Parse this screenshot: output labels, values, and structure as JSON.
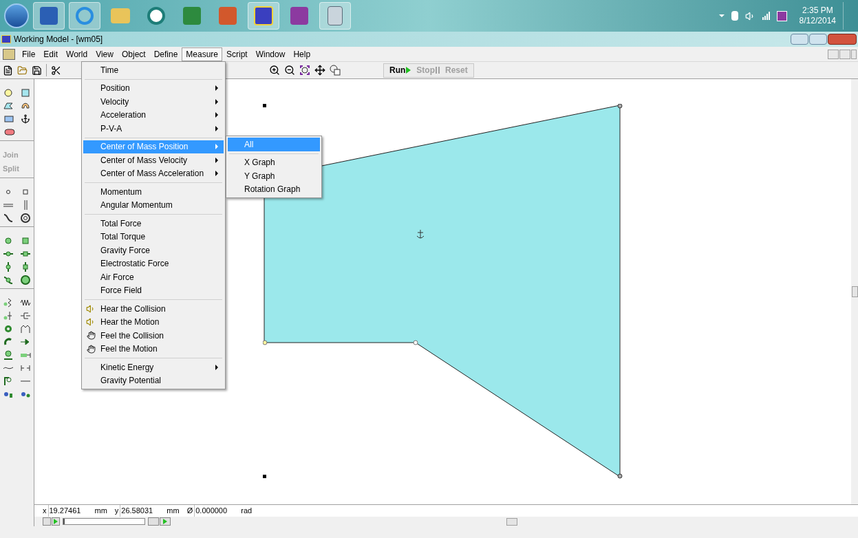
{
  "tray": {
    "time": "2:35 PM",
    "date": "8/12/2014"
  },
  "window": {
    "title": "Working Model - [wm05]"
  },
  "menubar": [
    {
      "label": "File",
      "selected": false
    },
    {
      "label": "Edit",
      "selected": false
    },
    {
      "label": "World",
      "selected": false
    },
    {
      "label": "View",
      "selected": false
    },
    {
      "label": "Object",
      "selected": false
    },
    {
      "label": "Define",
      "selected": false
    },
    {
      "label": "Measure",
      "selected": true
    },
    {
      "label": "Script",
      "selected": false
    },
    {
      "label": "Window",
      "selected": false
    },
    {
      "label": "Help",
      "selected": false
    }
  ],
  "run_controls": [
    {
      "label": "Run",
      "disabled": false
    },
    {
      "label": "Stop",
      "disabled": true
    },
    {
      "label": "Reset",
      "disabled": true
    }
  ],
  "palette_buttons": [
    {
      "label": "Join",
      "disabled": true
    },
    {
      "label": "Split",
      "disabled": true
    }
  ],
  "menu": {
    "groups": [
      [
        {
          "label": "Time",
          "kind": "plain",
          "selected": false
        }
      ],
      [
        {
          "label": "Position",
          "kind": "submenu",
          "selected": false
        },
        {
          "label": "Velocity",
          "kind": "submenu",
          "selected": false
        },
        {
          "label": "Acceleration",
          "kind": "submenu",
          "selected": false
        },
        {
          "label": "P-V-A",
          "kind": "submenu",
          "selected": false
        }
      ],
      [
        {
          "label": "Center of Mass Position",
          "kind": "submenu",
          "selected": true
        },
        {
          "label": "Center of Mass Velocity",
          "kind": "submenu",
          "selected": false
        },
        {
          "label": "Center of Mass Acceleration",
          "kind": "submenu",
          "selected": false
        }
      ],
      [
        {
          "label": "Momentum",
          "kind": "plain",
          "selected": false
        },
        {
          "label": "Angular Momentum",
          "kind": "plain",
          "selected": false
        }
      ],
      [
        {
          "label": "Total Force",
          "kind": "plain",
          "selected": false
        },
        {
          "label": "Total Torque",
          "kind": "plain",
          "selected": false
        },
        {
          "label": "Gravity Force",
          "kind": "plain",
          "selected": false
        },
        {
          "label": "Electrostatic Force",
          "kind": "plain",
          "selected": false
        },
        {
          "label": "Air Force",
          "kind": "plain",
          "selected": false
        },
        {
          "label": "Force Field",
          "kind": "plain",
          "selected": false
        }
      ],
      [
        {
          "label": "Hear the Collision",
          "kind": "speaker",
          "selected": false
        },
        {
          "label": "Hear the Motion",
          "kind": "speaker",
          "selected": false
        },
        {
          "label": "Feel the Collision",
          "kind": "hand",
          "selected": false
        },
        {
          "label": "Feel the Motion",
          "kind": "hand",
          "selected": false
        }
      ],
      [
        {
          "label": "Kinetic Energy",
          "kind": "submenu",
          "selected": false
        },
        {
          "label": "Gravity Potential",
          "kind": "plain",
          "selected": false
        }
      ]
    ]
  },
  "submenu": {
    "groups": [
      [
        {
          "label": "All",
          "selected": true
        }
      ],
      [
        {
          "label": "X Graph",
          "selected": false
        },
        {
          "label": "Y Graph",
          "selected": false
        },
        {
          "label": "Rotation Graph",
          "selected": false
        }
      ]
    ]
  },
  "tape": {
    "level": 0
  },
  "coordinates": [
    {
      "label": "x",
      "value": "19.27461",
      "unit": "mm"
    },
    {
      "label": "y",
      "value": "26.58031",
      "unit": "mm"
    },
    {
      "label": "Ø",
      "value": "0.000000",
      "unit": "rad"
    }
  ]
}
